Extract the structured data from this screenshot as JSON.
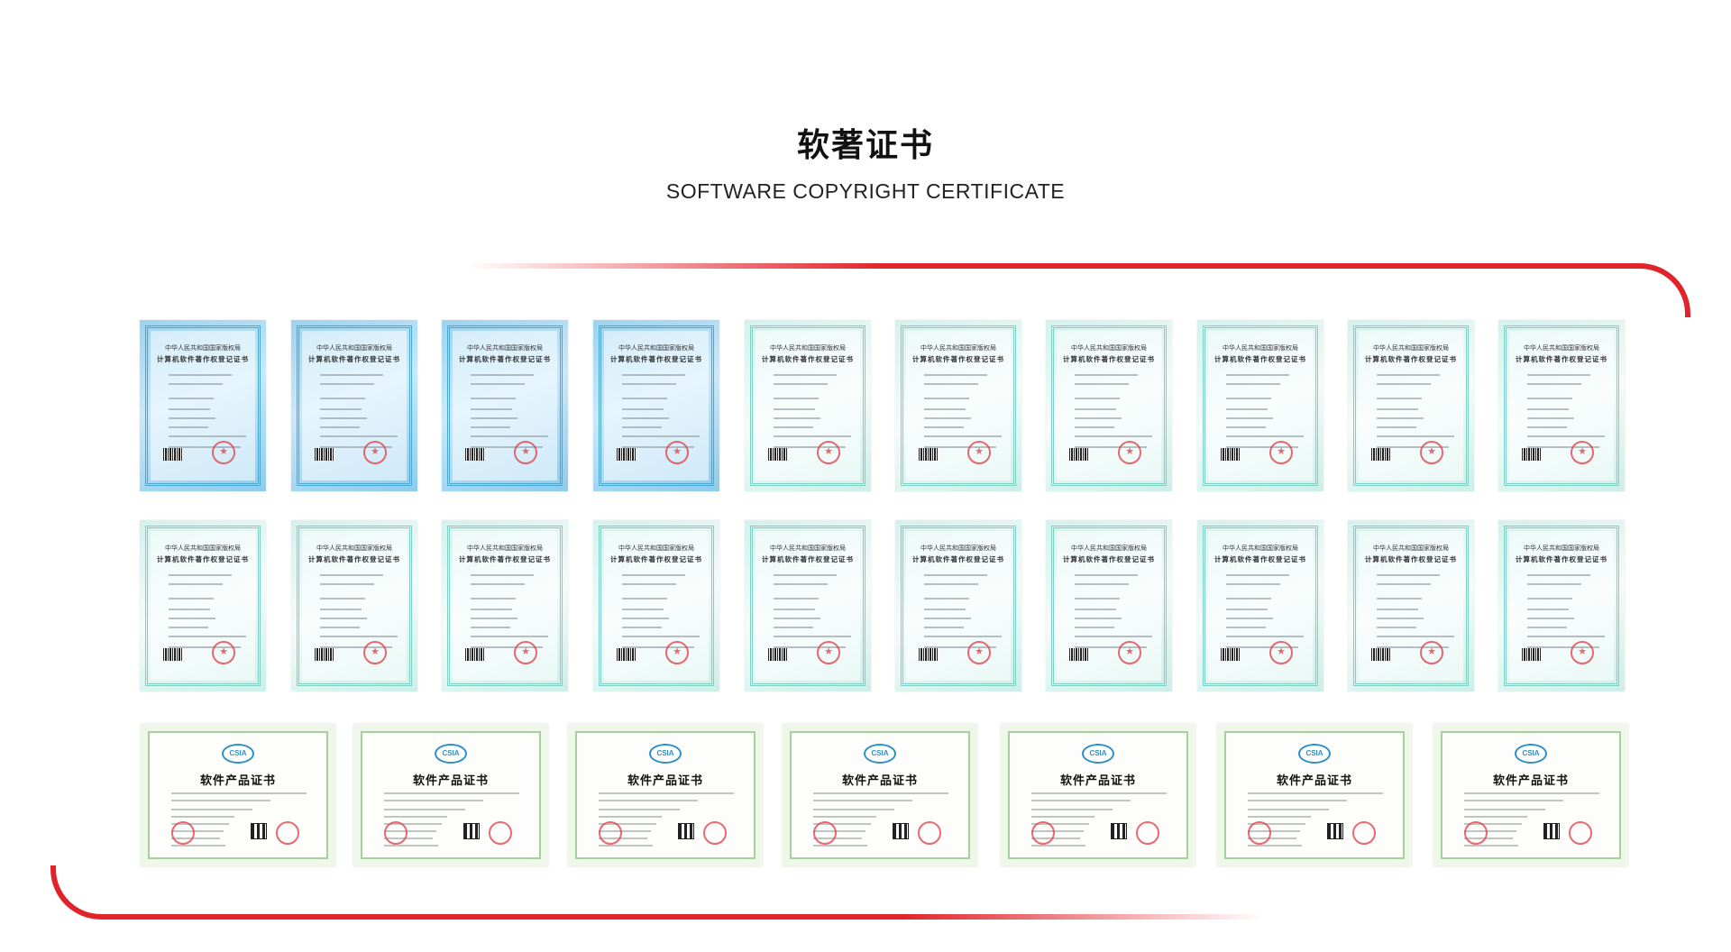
{
  "heading": {
    "title": "软著证书",
    "subtitle": "SOFTWARE COPYRIGHT CERTIFICATE"
  },
  "colors": {
    "accent_red": "#e1232b",
    "cert_blue": "#9cd3f0",
    "cert_green": "#d4f1ee",
    "product_cert_green": "#eef7e9"
  },
  "certificates": {
    "row1": [
      {
        "style": "blue",
        "line1": "中华人民共和国国家版权局",
        "line2": "计算机软件著作权登记证书"
      },
      {
        "style": "blue",
        "line1": "中华人民共和国国家版权局",
        "line2": "计算机软件著作权登记证书"
      },
      {
        "style": "blue",
        "line1": "中华人民共和国国家版权局",
        "line2": "计算机软件著作权登记证书"
      },
      {
        "style": "blue",
        "line1": "中华人民共和国国家版权局",
        "line2": "计算机软件著作权登记证书"
      },
      {
        "style": "green",
        "line1": "中华人民共和国国家版权局",
        "line2": "计算机软件著作权登记证书"
      },
      {
        "style": "green",
        "line1": "中华人民共和国国家版权局",
        "line2": "计算机软件著作权登记证书"
      },
      {
        "style": "green",
        "line1": "中华人民共和国国家版权局",
        "line2": "计算机软件著作权登记证书"
      },
      {
        "style": "green",
        "line1": "中华人民共和国国家版权局",
        "line2": "计算机软件著作权登记证书"
      },
      {
        "style": "green",
        "line1": "中华人民共和国国家版权局",
        "line2": "计算机软件著作权登记证书"
      },
      {
        "style": "green",
        "line1": "中华人民共和国国家版权局",
        "line2": "计算机软件著作权登记证书"
      }
    ],
    "row2": [
      {
        "style": "green",
        "line1": "中华人民共和国国家版权局",
        "line2": "计算机软件著作权登记证书"
      },
      {
        "style": "green",
        "line1": "中华人民共和国国家版权局",
        "line2": "计算机软件著作权登记证书"
      },
      {
        "style": "green",
        "line1": "中华人民共和国国家版权局",
        "line2": "计算机软件著作权登记证书"
      },
      {
        "style": "green",
        "line1": "中华人民共和国国家版权局",
        "line2": "计算机软件著作权登记证书"
      },
      {
        "style": "green",
        "line1": "中华人民共和国国家版权局",
        "line2": "计算机软件著作权登记证书"
      },
      {
        "style": "green",
        "line1": "中华人民共和国国家版权局",
        "line2": "计算机软件著作权登记证书"
      },
      {
        "style": "green",
        "line1": "中华人民共和国国家版权局",
        "line2": "计算机软件著作权登记证书"
      },
      {
        "style": "green",
        "line1": "中华人民共和国国家版权局",
        "line2": "计算机软件著作权登记证书"
      },
      {
        "style": "green",
        "line1": "中华人民共和国国家版权局",
        "line2": "计算机软件著作权登记证书"
      },
      {
        "style": "green",
        "line1": "中华人民共和国国家版权局",
        "line2": "计算机软件著作权登记证书"
      }
    ],
    "row3": [
      {
        "logo": "CSIA",
        "title": "软件产品证书"
      },
      {
        "logo": "CSIA",
        "title": "软件产品证书"
      },
      {
        "logo": "CSIA",
        "title": "软件产品证书"
      },
      {
        "logo": "CSIA",
        "title": "软件产品证书"
      },
      {
        "logo": "CSIA",
        "title": "软件产品证书"
      },
      {
        "logo": "CSIA",
        "title": "软件产品证书"
      },
      {
        "logo": "CSIA",
        "title": "软件产品证书"
      }
    ]
  }
}
